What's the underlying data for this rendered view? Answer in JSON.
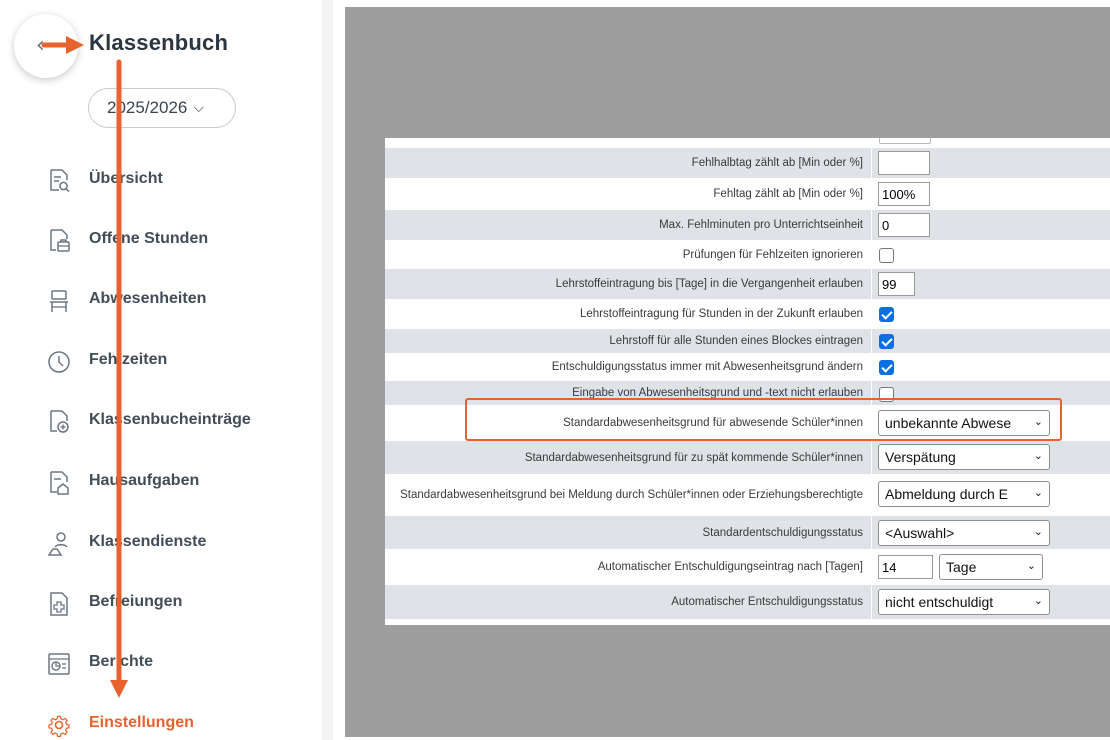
{
  "sidebar": {
    "title": "Klassenbuch",
    "year": "2025/2026",
    "items": [
      {
        "label": "Übersicht",
        "icon": "document-search-icon"
      },
      {
        "label": "Offene Stunden",
        "icon": "document-briefcase-icon"
      },
      {
        "label": "Abwesenheiten",
        "icon": "chair-icon"
      },
      {
        "label": "Fehlzeiten",
        "icon": "clock-icon"
      },
      {
        "label": "Klassenbucheinträge",
        "icon": "document-plus-icon"
      },
      {
        "label": "Hausaufgaben",
        "icon": "document-house-icon"
      },
      {
        "label": "Klassendienste",
        "icon": "person-service-icon"
      },
      {
        "label": "Befreiungen",
        "icon": "medical-document-icon"
      },
      {
        "label": "Berichte",
        "icon": "report-icon"
      },
      {
        "label": "Einstellungen",
        "icon": "gear-icon"
      }
    ],
    "active": "Einstellungen",
    "accent": "#e8622d"
  },
  "settings": {
    "rows": [
      {
        "label": "Fehlhalbtag zählt ab [Min oder %]",
        "type": "text",
        "value": ""
      },
      {
        "label": "Fehltag zählt ab [Min oder %]",
        "type": "text",
        "value": "100%"
      },
      {
        "label": "Max. Fehlminuten pro Unterrichtseinheit",
        "type": "text",
        "value": "0"
      },
      {
        "label": "Prüfungen für Fehlzeiten ignorieren",
        "type": "checkbox",
        "checked": false
      },
      {
        "label": "Lehrstoffeintragung bis [Tage] in die Vergangenheit erlauben",
        "type": "text",
        "value": "99"
      },
      {
        "label": "Lehrstoffeintragung für Stunden in der Zukunft erlauben",
        "type": "checkbox",
        "checked": true
      },
      {
        "label": "Lehrstoff für alle Stunden eines Blockes eintragen",
        "type": "checkbox",
        "checked": true
      },
      {
        "label": "Entschuldigungsstatus immer mit Abwesenheitsgrund ändern",
        "type": "checkbox",
        "checked": true
      },
      {
        "label": "Eingabe von Abwesenheitsgrund und -text nicht erlauben",
        "type": "checkbox",
        "checked": false
      },
      {
        "label": "Standardabwesenheitsgrund für abwesende Schüler*innen",
        "type": "select",
        "value": "unbekannte Abwese"
      },
      {
        "label": "Standardabwesenheitsgrund für zu spät kommende Schüler*innen",
        "type": "select",
        "value": "Verspätung"
      },
      {
        "label": "Standardabwesenheitsgrund bei Meldung durch Schüler*innen oder Erziehungsberechtigte",
        "type": "select",
        "value": "Abmeldung durch E"
      },
      {
        "label": "Standardentschuldigungsstatus",
        "type": "select",
        "value": "<Auswahl>"
      },
      {
        "label": "Automatischer Entschuldigungseintrag nach [Tagen]",
        "type": "text+select",
        "value": "14",
        "unit": "Tage"
      },
      {
        "label": "Automatischer Entschuldigungsstatus",
        "type": "select",
        "value": "nicht entschuldigt"
      }
    ]
  }
}
